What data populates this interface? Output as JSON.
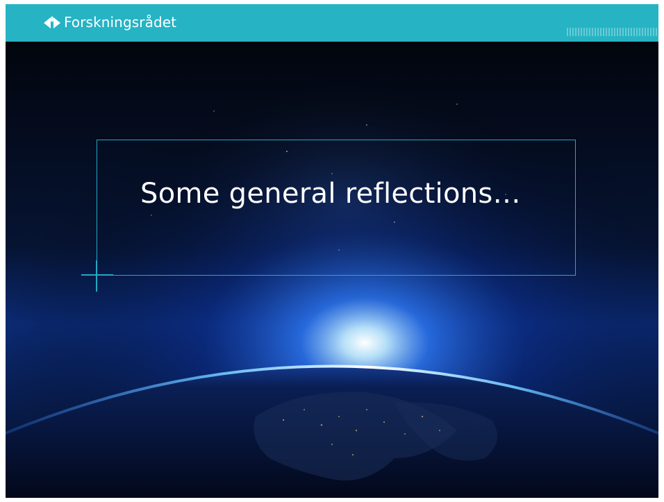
{
  "header": {
    "brand_name": "Forskningsrådet",
    "logo_icon": "forskningsradet-logo-icon",
    "background_color": "#26b3c4"
  },
  "slide": {
    "title": "Some general reflections…",
    "accent_color": "#24a9c4",
    "background_image": "earth-from-space-at-night"
  }
}
